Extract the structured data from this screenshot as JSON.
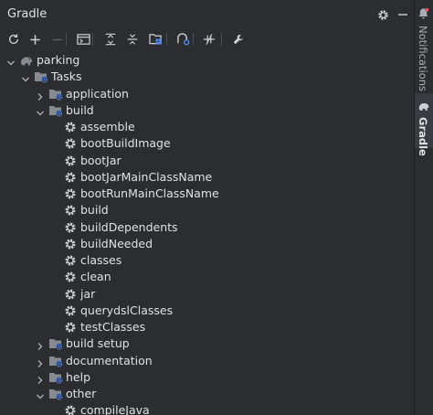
{
  "panel": {
    "title": "Gradle"
  },
  "header_icons": [
    {
      "name": "gear-icon"
    },
    {
      "name": "minimize-icon"
    }
  ],
  "toolbar": [
    {
      "name": "reload-icon",
      "enabled": true
    },
    {
      "name": "add-icon",
      "enabled": true
    },
    {
      "name": "remove-icon",
      "enabled": false
    },
    {
      "name": "execute-task-icon",
      "enabled": true
    },
    {
      "name": "expand-all-icon",
      "enabled": true
    },
    {
      "name": "collapse-all-icon",
      "enabled": true
    },
    {
      "name": "group-modules-icon",
      "enabled": true
    },
    {
      "name": "analyze-dependencies-icon",
      "enabled": true
    },
    {
      "name": "toggle-offline-icon",
      "enabled": true
    },
    {
      "name": "build-settings-icon",
      "enabled": true
    }
  ],
  "tree": [
    {
      "label": "parking",
      "depth": 0,
      "kind": "project",
      "expanded": true
    },
    {
      "label": "Tasks",
      "depth": 1,
      "kind": "folder",
      "expanded": true
    },
    {
      "label": "application",
      "depth": 2,
      "kind": "folder",
      "expanded": false
    },
    {
      "label": "build",
      "depth": 2,
      "kind": "folder",
      "expanded": true
    },
    {
      "label": "assemble",
      "depth": 3,
      "kind": "task"
    },
    {
      "label": "bootBuildImage",
      "depth": 3,
      "kind": "task"
    },
    {
      "label": "bootJar",
      "depth": 3,
      "kind": "task"
    },
    {
      "label": "bootJarMainClassName",
      "depth": 3,
      "kind": "task"
    },
    {
      "label": "bootRunMainClassName",
      "depth": 3,
      "kind": "task"
    },
    {
      "label": "build",
      "depth": 3,
      "kind": "task"
    },
    {
      "label": "buildDependents",
      "depth": 3,
      "kind": "task"
    },
    {
      "label": "buildNeeded",
      "depth": 3,
      "kind": "task"
    },
    {
      "label": "classes",
      "depth": 3,
      "kind": "task"
    },
    {
      "label": "clean",
      "depth": 3,
      "kind": "task"
    },
    {
      "label": "jar",
      "depth": 3,
      "kind": "task"
    },
    {
      "label": "querydslClasses",
      "depth": 3,
      "kind": "task"
    },
    {
      "label": "testClasses",
      "depth": 3,
      "kind": "task"
    },
    {
      "label": "build setup",
      "depth": 2,
      "kind": "folder",
      "expanded": false
    },
    {
      "label": "documentation",
      "depth": 2,
      "kind": "folder",
      "expanded": false
    },
    {
      "label": "help",
      "depth": 2,
      "kind": "folder",
      "expanded": false
    },
    {
      "label": "other",
      "depth": 2,
      "kind": "folder",
      "expanded": true
    },
    {
      "label": "compileJava",
      "depth": 3,
      "kind": "task"
    }
  ],
  "right_tabs": [
    {
      "label": "Notifications",
      "icon": "bell-icon",
      "active": false
    },
    {
      "label": "Gradle",
      "icon": "elephant-icon",
      "active": true
    }
  ],
  "colors": {
    "background": "#2b2d30",
    "text": "#dfe1e5",
    "icon": "#ced0d6",
    "folder_badge": "#548af7"
  }
}
